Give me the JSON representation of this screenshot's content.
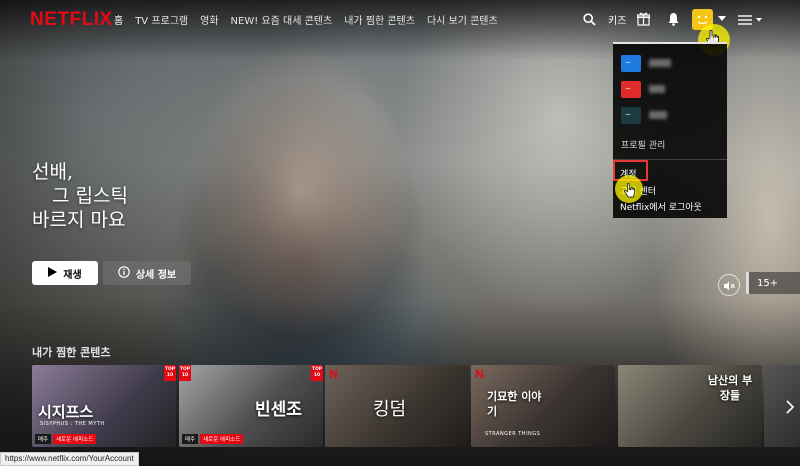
{
  "brand": {
    "logo": "NETFLIX"
  },
  "nav": {
    "links": [
      "홈",
      "TV 프로그램",
      "영화",
      "NEW! 요즘 대세 콘텐츠",
      "내가 찜한 콘텐츠",
      "다시 보기 콘텐츠"
    ],
    "kids_label": "키즈"
  },
  "profile_menu": {
    "manage_label": "프로필 관리",
    "account_label": "계정",
    "help_label": "고객 센터",
    "logout_label": "Netflix에서 로그아웃",
    "profile_colors": [
      "#1f7ae0",
      "#e02b2b",
      "#1d3a40"
    ]
  },
  "hero": {
    "title_lines": [
      "선배,",
      "그 립스틱",
      "바르지 마요"
    ],
    "play_label": "재생",
    "info_label": "상세 정보",
    "maturity_rating": "15+"
  },
  "row": {
    "title": "내가 찜한 콘텐츠",
    "cards": [
      {
        "title": "시지프스",
        "subtitle": "SISYPHUS : THE MYTH",
        "badges": [
          "매주",
          "새로운 에피소드"
        ],
        "top10": true,
        "n_badge": false,
        "color": "#5c5866"
      },
      {
        "title": "빈센조",
        "subtitle": "",
        "badges": [
          "매주",
          "새로운 에피소드"
        ],
        "top10": true,
        "n_badge": false,
        "color": "#6e6e70"
      },
      {
        "title": "킹덤",
        "subtitle": "",
        "badges": [],
        "top10": false,
        "n_badge": true,
        "color": "#4a4540"
      },
      {
        "title": "기묘한 이야기",
        "subtitle": "STRANGER THINGS",
        "badges": [],
        "top10": false,
        "n_badge": true,
        "color": "#3f3a37"
      },
      {
        "title": "남산의 부장들",
        "subtitle": "",
        "badges": [],
        "top10": false,
        "n_badge": false,
        "color": "#4e4b45"
      },
      {
        "title": "",
        "subtitle": "",
        "badges": [],
        "top10": false,
        "n_badge": false,
        "color": "#3a3a3a"
      }
    ],
    "top10_label": "TOP 10",
    "n_label": "N"
  },
  "status_bar": {
    "url": "https://www.netflix.com/YourAccount"
  },
  "icons": [
    "search-icon",
    "gift-icon",
    "bell-icon",
    "profile-avatar",
    "caret-down-icon",
    "play-icon",
    "info-icon",
    "mute-icon"
  ]
}
